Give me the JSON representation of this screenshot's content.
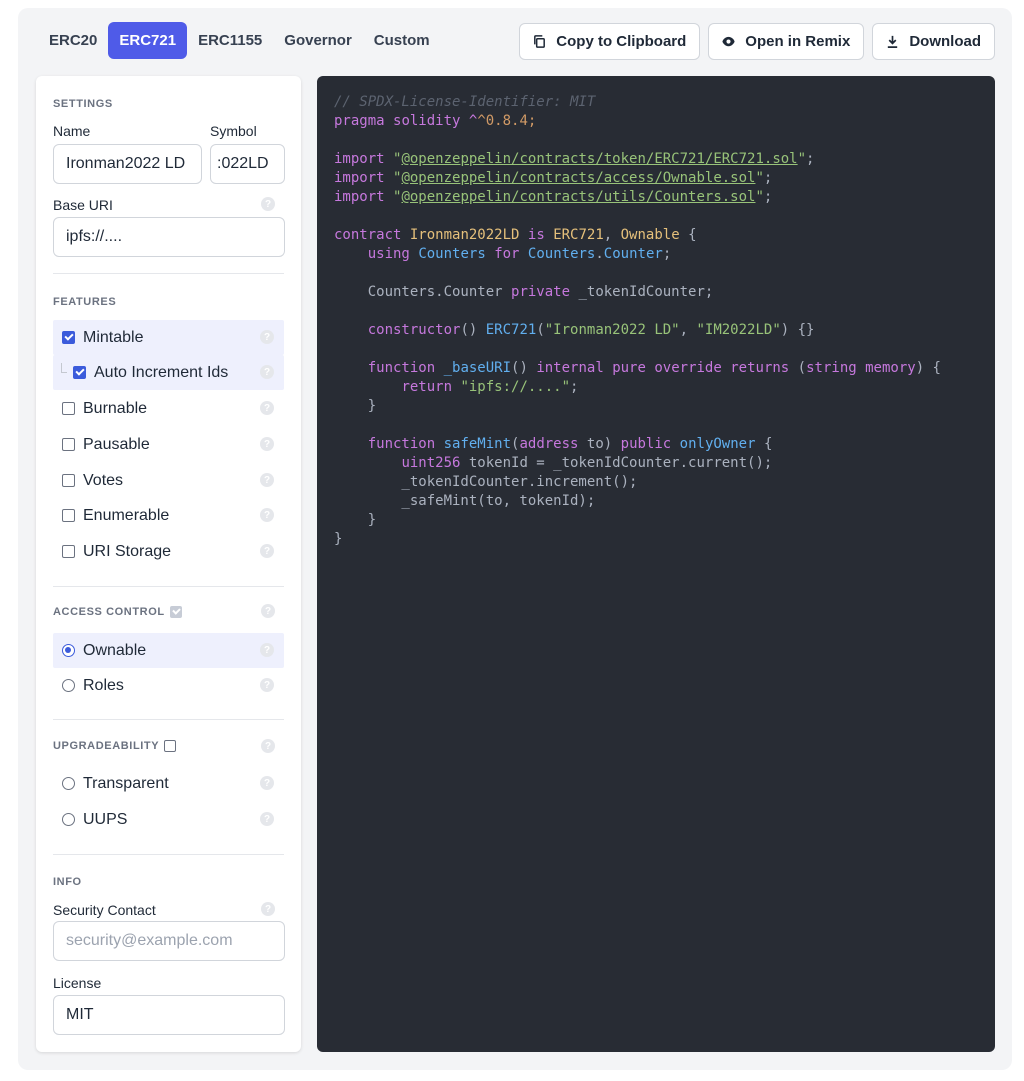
{
  "tabs": [
    "ERC20",
    "ERC721",
    "ERC1155",
    "Governor",
    "Custom"
  ],
  "active_tab": "ERC721",
  "actions": {
    "copy": "Copy to Clipboard",
    "remix": "Open in Remix",
    "download": "Download"
  },
  "settings": {
    "title": "SETTINGS",
    "name_label": "Name",
    "name_value": "Ironman2022 LD",
    "symbol_label": "Symbol",
    "symbol_value": ":022LD",
    "base_uri_label": "Base URI",
    "base_uri_value": "ipfs://...."
  },
  "features": {
    "title": "FEATURES",
    "items": [
      {
        "label": "Mintable",
        "checked": true
      },
      {
        "label": "Auto Increment Ids",
        "checked": true
      },
      {
        "label": "Burnable",
        "checked": false
      },
      {
        "label": "Pausable",
        "checked": false
      },
      {
        "label": "Votes",
        "checked": false
      },
      {
        "label": "Enumerable",
        "checked": false
      },
      {
        "label": "URI Storage",
        "checked": false
      }
    ]
  },
  "access_control": {
    "title": "ACCESS CONTROL",
    "options": [
      {
        "label": "Ownable",
        "selected": true
      },
      {
        "label": "Roles",
        "selected": false
      }
    ]
  },
  "upgradeability": {
    "title": "UPGRADEABILITY",
    "options": [
      {
        "label": "Transparent",
        "selected": false
      },
      {
        "label": "UUPS",
        "selected": false
      }
    ]
  },
  "info": {
    "title": "INFO",
    "security_label": "Security Contact",
    "security_placeholder": "security@example.com",
    "license_label": "License",
    "license_value": "MIT"
  },
  "code": {
    "license_comment": "// SPDX-License-Identifier: MIT",
    "pragma": "^0.8.4;",
    "imports": [
      "@openzeppelin/contracts/token/ERC721/ERC721.sol",
      "@openzeppelin/contracts/access/Ownable.sol",
      "@openzeppelin/contracts/utils/Counters.sol"
    ],
    "contract_name": "Ironman2022LD",
    "token_name": "\"Ironman2022 LD\"",
    "token_symbol": "\"IM2022LD\"",
    "base_uri": "\"ipfs://....\""
  },
  "colors": {
    "accent": "#4f5be8",
    "code_bg": "#282c34"
  }
}
